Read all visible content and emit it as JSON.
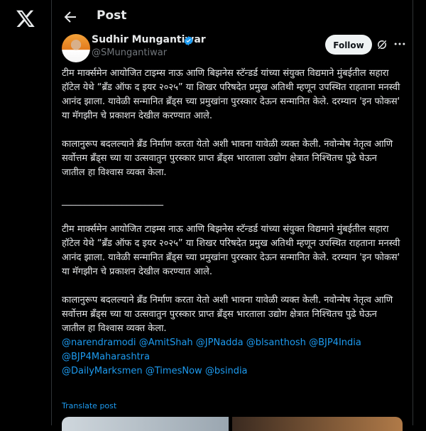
{
  "nav": {
    "logo_icon": "x-logo-icon"
  },
  "header": {
    "title": "Post",
    "back_icon": "arrow-left-icon"
  },
  "author": {
    "name": "Sudhir Mungantiwar",
    "handle": "@SMungantiwar",
    "verified_color": "#1d9bf0",
    "follow_label": "Follow"
  },
  "post": {
    "paragraphs": [
      "टीम मार्क्समेन आयोजित टाइम्स नाऊ आणि बिझनेस स्टॅन्डर्ड यांच्या संयुक्त विद्यमाने मुंबईतील सहारा हॉटेल येथे “ब्रँड ऑफ द इयर २०२५” या शिखर परिषदेत प्रमुख अतिथी म्हणून उपस्थित राहताना मनस्वी आनंद झाला. यावेळी सन्मानित ब्रँड्स च्या प्रमुखांना पुरस्कार देऊन सन्मानित केले. दरम्यान 'इन फोकस' या मॅगझीन चे प्रकाशन देखील करण्यात आले.",
      "कालानुरूप बदलल्याने ब्रँड निर्माण करता येतो अशी भावना यावेळी व्यक्त केली. नवोन्मेष नेतृत्व आणि सर्वोत्तम ब्रँड्स च्या या उत्सवातुन पुरस्कार प्राप्त ब्रँड्स भारताला उद्योग क्षेत्रात निश्चितच पुढे घेऊन जातील हा विश्वास व्यक्त केला.",
      "______________________",
      "टीम मार्क्समेन आयोजित टाइम्स नाऊ आणि बिझनेस स्टॅन्डर्ड यांच्या संयुक्त विद्यमाने मुंबईतील सहारा हॉटेल येथे “ब्रँड ऑफ द इयर २०२५” या शिखर परिषदेत प्रमुख अतिथी म्हणून उपस्थित राहताना मनस्वी आनंद झाला. यावेळी सन्मानित ब्रँड्स च्या प्रमुखांना पुरस्कार देऊन सन्मानित केले. दरम्यान 'इन फोकस' या मॅगझीन चे प्रकाशन देखील करण्यात आले.",
      "कालानुरूप बदलल्याने ब्रँड निर्माण करता येतो अशी भावना यावेळी व्यक्त केली. नवोन्मेष नेतृत्व आणि सर्वोत्तम ब्रँड्स च्या या उत्सवातुन पुरस्कार प्राप्त ब्रँड्स भारताला उद्योग क्षेत्रात निश्चितच पुढे घेऊन जातील हा विश्वास व्यक्त केला."
    ],
    "mentions": [
      "@narendramodi",
      "@AmitShah",
      "@JPNadda",
      "@blsanthosh",
      "@BJP4India",
      "@BJP4Maharashtra",
      "@DailyMarksmen",
      "@TimesNow",
      "@bsindia"
    ],
    "translate_label": "Translate post",
    "link_color": "#1d9bf0"
  }
}
